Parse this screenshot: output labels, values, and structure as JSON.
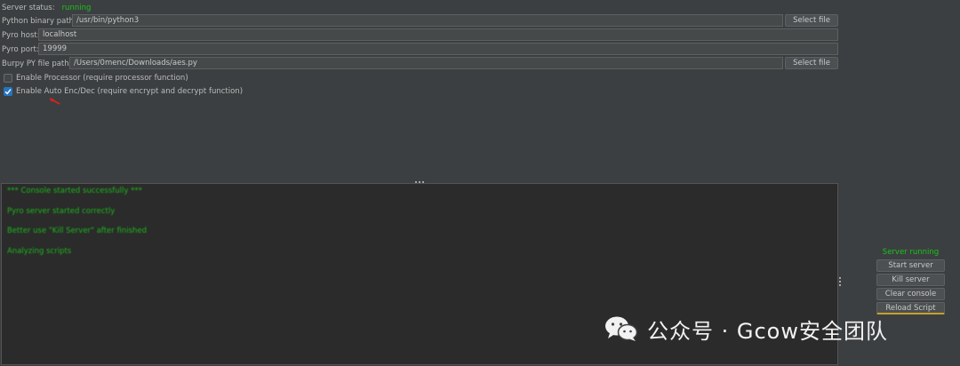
{
  "server_status": {
    "label": "Server status:",
    "value": "running"
  },
  "fields": {
    "python_binary": {
      "label": "Python binary path:",
      "value": "/usr/bin/python3",
      "button": "Select file"
    },
    "pyro_host": {
      "label": "Pyro host:",
      "value": "localhost"
    },
    "pyro_port": {
      "label": "Pyro port:",
      "value": "19999"
    },
    "burpy_py": {
      "label": "Burpy PY file path:",
      "value": "/Users/0menc/Downloads/aes.py",
      "button": "Select file"
    }
  },
  "checkboxes": {
    "processor": {
      "label": "Enable Processor (require processor function)",
      "checked": false
    },
    "auto_encdec": {
      "label": "Enable Auto Enc/Dec (require encrypt and decrypt function)",
      "checked": true
    }
  },
  "console": {
    "lines": [
      "*** Console started successfully ***",
      "Pyro server started correctly",
      "Better use \"Kill Server\" after finished",
      "Analyzing scripts"
    ]
  },
  "side_panel": {
    "status": "Server running",
    "buttons": [
      "Start server",
      "Kill server",
      "Clear console",
      "Reload Script"
    ]
  },
  "watermark": {
    "text": "公众号 · Gcow安全团队"
  },
  "colors": {
    "status_green": "#19c319",
    "console_green": "#1cb51c",
    "checkbox_blue": "#2675bf",
    "arrow_red": "#e02020"
  }
}
